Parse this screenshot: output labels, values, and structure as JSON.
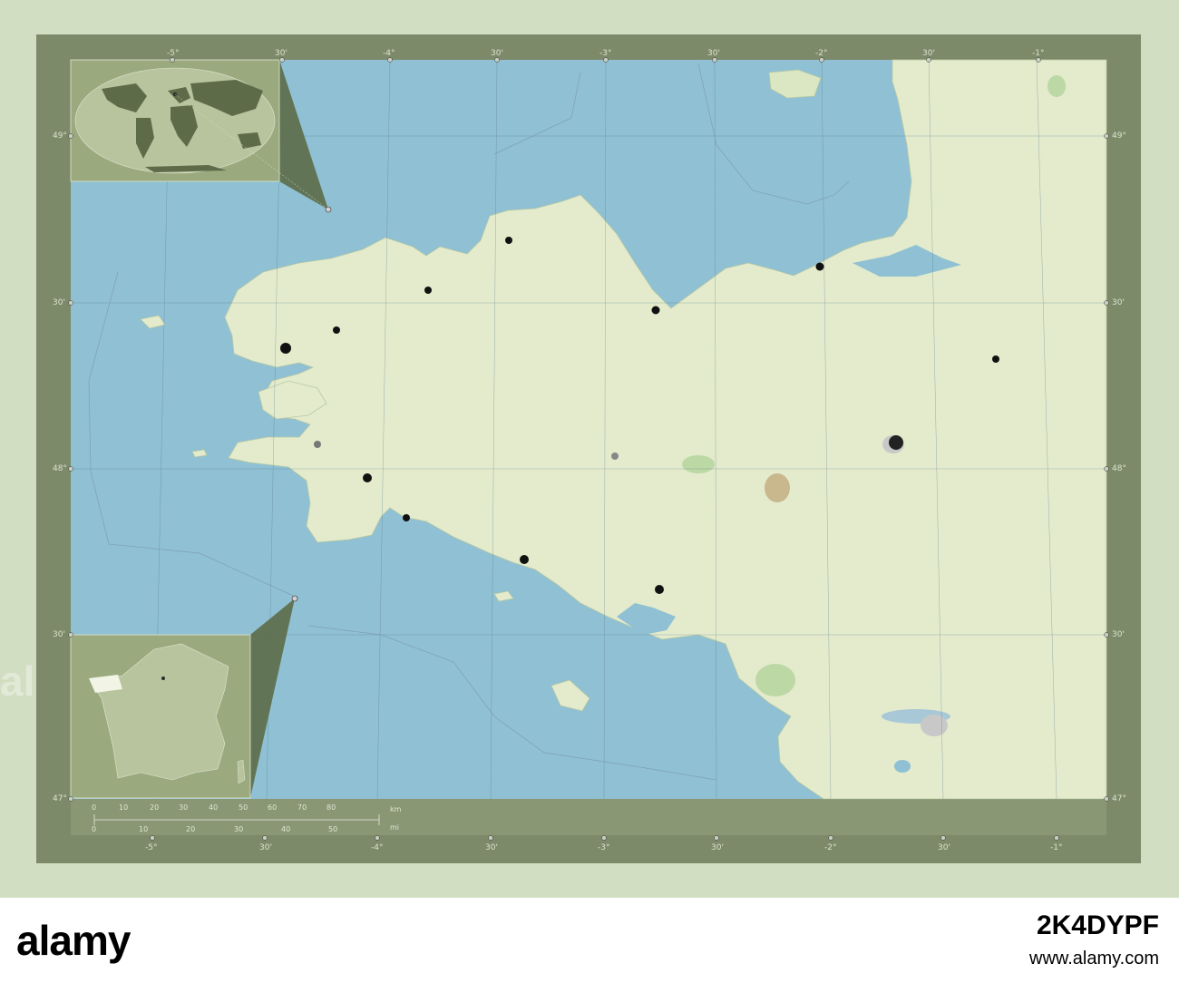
{
  "map": {
    "colors": {
      "sea": "#8fc0d3",
      "land": "#e3ebcc",
      "frame": "#7d8a6a",
      "inset": "#b7c49e",
      "inset_dark": "#5d6b48"
    },
    "top_ticks": [
      "-5°",
      "30'",
      "-4°",
      "30'",
      "-3°",
      "30'",
      "-2°",
      "30'",
      "-1°"
    ],
    "bottom_ticks": [
      "-5°",
      "30'",
      "-4°",
      "30'",
      "-3°",
      "30'",
      "-2°",
      "30'",
      "-1°"
    ],
    "left_ticks": [
      "49°",
      "30'",
      "48°",
      "30'",
      "47°"
    ],
    "right_ticks": [
      "49°",
      "30'",
      "48°",
      "30'",
      "47°"
    ],
    "scale": {
      "km_unit": "km",
      "mi_unit": "mi",
      "km_values": [
        "0",
        "10",
        "20",
        "30",
        "40",
        "50",
        "60",
        "70",
        "80"
      ],
      "mi_values": [
        "0",
        "10",
        "20",
        "30",
        "40",
        "50"
      ]
    }
  },
  "watermark": {
    "logo": "alamy",
    "image_id": "2K4DYPF",
    "line": "www.alamy.com"
  }
}
